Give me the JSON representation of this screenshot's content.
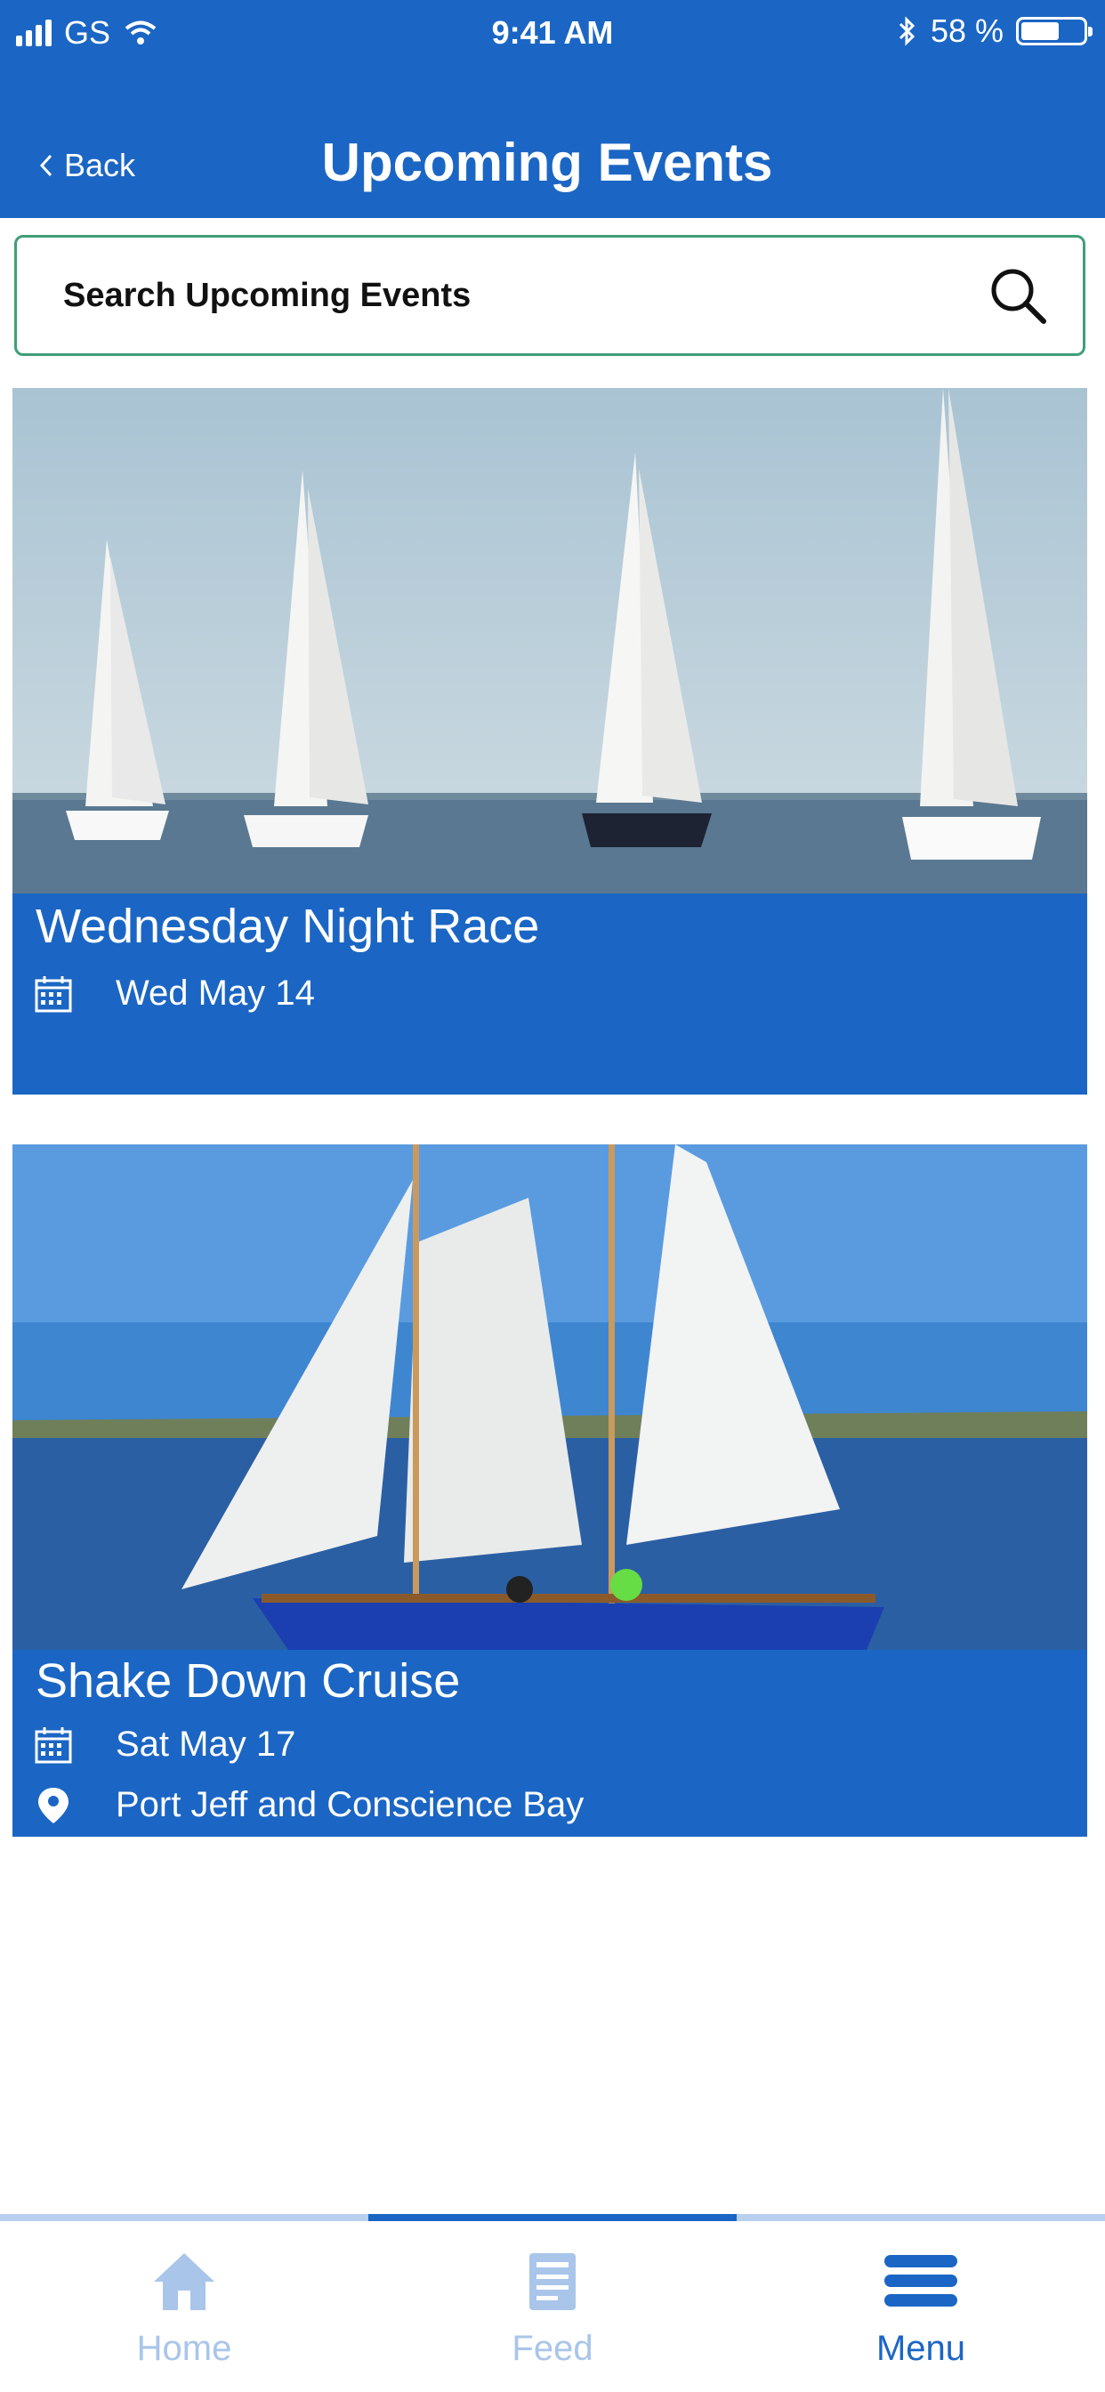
{
  "status_bar": {
    "carrier": "GS",
    "time": "9:41 AM",
    "battery": "58 %",
    "battery_level": 0.58
  },
  "header": {
    "back_label": "Back",
    "title": "Upcoming Events"
  },
  "search": {
    "placeholder": "Search Upcoming Events"
  },
  "events": [
    {
      "name": "Wednesday Night Race",
      "date": "Wed May 14"
    },
    {
      "name": "Shake Down Cruise",
      "date": "Sat May 17",
      "location": "Port Jeff and Conscience Bay"
    }
  ],
  "tabs": [
    {
      "label": "Home",
      "icon": "home-icon",
      "active": false
    },
    {
      "label": "Feed",
      "icon": "feed-icon",
      "active": false
    },
    {
      "label": "Menu",
      "icon": "menu-icon",
      "active": true
    }
  ],
  "colors": {
    "brand": "#1b66c4",
    "search_border": "#3f9e78",
    "inactive_tab": "#a9c5ea"
  }
}
